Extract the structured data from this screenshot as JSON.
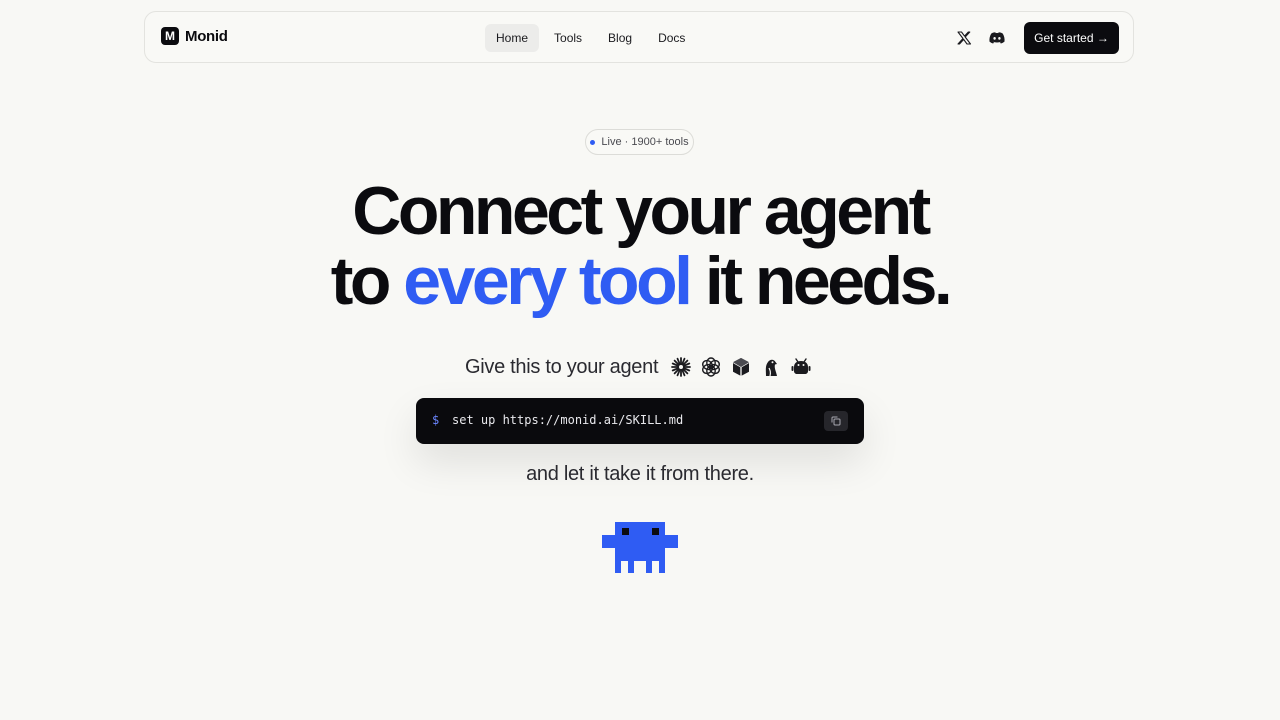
{
  "brand": {
    "mark": "M",
    "name": "Monid"
  },
  "nav": {
    "links": [
      {
        "label": "Home",
        "active": true
      },
      {
        "label": "Tools",
        "active": false
      },
      {
        "label": "Blog",
        "active": false
      },
      {
        "label": "Docs",
        "active": false
      }
    ],
    "social": [
      "x-icon",
      "discord-icon"
    ],
    "cta_label": "Get started →"
  },
  "hero": {
    "pill": "Live · 1900+ tools",
    "headline_line1": "Connect your agent",
    "headline_line2_pre": "to ",
    "headline_line2_accent": "every tool",
    "headline_line2_post": " it needs.",
    "give_label": "Give this to your agent",
    "agent_icons": [
      "claude-icon",
      "openai-icon",
      "cube-icon",
      "goose-icon",
      "android-icon"
    ],
    "command_prompt": "$",
    "command": "set up https://monid.ai/SKILL.md",
    "after_label": "and let it take it from there."
  },
  "colors": {
    "accent": "#2f5cf3",
    "dark": "#0b0b0f",
    "background": "#f8f8f5"
  }
}
